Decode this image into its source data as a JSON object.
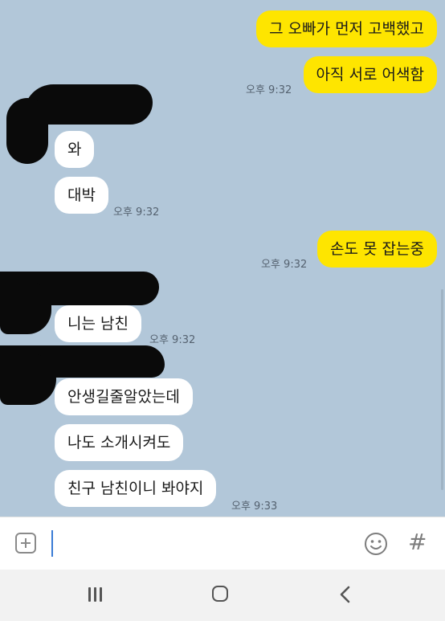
{
  "messages": [
    {
      "text": "그 오빠가 먼저 고백했고",
      "sender": "me"
    },
    {
      "text": "아직 서로 어색함",
      "sender": "me",
      "time": "오후 9:32"
    },
    {
      "text": "와",
      "sender": "friend"
    },
    {
      "text": "대박",
      "sender": "friend",
      "time": "오후 9:32"
    },
    {
      "text": "손도 못 잡는중",
      "sender": "me",
      "time": "오후 9:32"
    },
    {
      "text": "니는 남친",
      "sender": "friend",
      "time": "오후 9:32"
    },
    {
      "text": "안생길줄알았는데",
      "sender": "friend"
    },
    {
      "text": "나도 소개시켜도",
      "sender": "friend"
    },
    {
      "text": "친구 남친이니 봐야지",
      "sender": "friend",
      "time": "오후 9:33"
    }
  ],
  "input_bar": {
    "hash_symbol": "#",
    "icons": [
      "plus-icon",
      "emoji-icon",
      "hash-icon"
    ]
  },
  "navigation": {
    "icons": [
      "recent-apps-icon",
      "home-icon",
      "back-icon"
    ]
  },
  "colors": {
    "chat_background": "#b2c7d9",
    "my_bubble": "#fee500",
    "friend_bubble": "#ffffff"
  }
}
